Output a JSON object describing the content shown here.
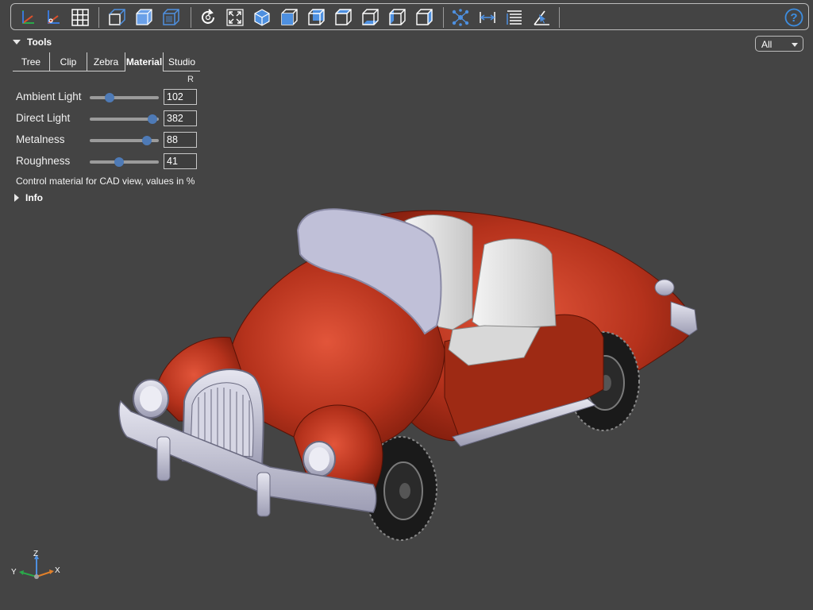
{
  "toolbar": {
    "buttons": [
      {
        "name": "axes-toggle-icon"
      },
      {
        "name": "axes-origin-icon"
      },
      {
        "name": "grid-icon"
      },
      {
        "name": "perspective-camera-icon"
      },
      {
        "name": "ortho-transparent-icon"
      },
      {
        "name": "black-edges-icon"
      },
      {
        "name": "reset-view-icon"
      },
      {
        "name": "fit-view-icon"
      },
      {
        "name": "view-iso-icon"
      },
      {
        "name": "view-front-icon"
      },
      {
        "name": "view-rear-icon"
      },
      {
        "name": "view-top-icon"
      },
      {
        "name": "view-bottom-icon"
      },
      {
        "name": "view-left-icon"
      },
      {
        "name": "view-right-icon"
      },
      {
        "name": "explode-icon"
      },
      {
        "name": "measure-distance-icon"
      },
      {
        "name": "properties-icon"
      },
      {
        "name": "angle-measure-icon"
      }
    ],
    "help": "?"
  },
  "tools": {
    "title": "Tools",
    "tabs": [
      {
        "label": "Tree",
        "active": false
      },
      {
        "label": "Clip",
        "active": false
      },
      {
        "label": "Zebra",
        "active": false
      },
      {
        "label": "Material",
        "active": true
      },
      {
        "label": "Studio",
        "active": false
      }
    ],
    "reset_label": "R",
    "sliders": [
      {
        "label": "Ambient Light",
        "value": "102",
        "fraction": 0.29
      },
      {
        "label": "Direct Light",
        "value": "382",
        "fraction": 0.91
      },
      {
        "label": "Metalness",
        "value": "88",
        "fraction": 0.83
      },
      {
        "label": "Roughness",
        "value": "41",
        "fraction": 0.42
      }
    ],
    "help_text": "Control material for CAD view, values in %"
  },
  "info": {
    "title": "Info"
  },
  "filter": {
    "selected": "All"
  },
  "axes": {
    "x": "X",
    "y": "Y",
    "z": "Z"
  },
  "colors": {
    "background": "#444444",
    "accent": "#4e7ab6",
    "body_red": "#b5321c",
    "trim": "#c5c5d8"
  }
}
